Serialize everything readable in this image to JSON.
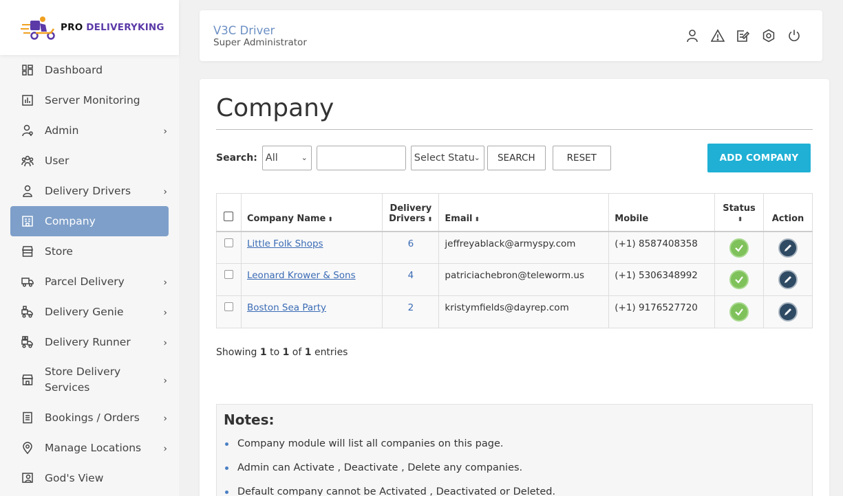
{
  "brand": {
    "pro": "PRO",
    "name": "DELIVERYKING"
  },
  "header": {
    "user_name": "V3C Driver",
    "user_role": "Super Administrator"
  },
  "sidebar": {
    "items": [
      {
        "label": "Dashboard",
        "icon": "dashboard-icon",
        "has_submenu": false
      },
      {
        "label": "Server Monitoring",
        "icon": "chart-icon",
        "has_submenu": false
      },
      {
        "label": "Admin",
        "icon": "admin-user-icon",
        "has_submenu": true
      },
      {
        "label": "User",
        "icon": "users-icon",
        "has_submenu": false
      },
      {
        "label": "Delivery Drivers",
        "icon": "driver-icon",
        "has_submenu": true
      },
      {
        "label": "Company",
        "icon": "building-icon",
        "has_submenu": false,
        "active": true
      },
      {
        "label": "Store",
        "icon": "store-icon",
        "has_submenu": false
      },
      {
        "label": "Parcel Delivery",
        "icon": "truck-icon",
        "has_submenu": true
      },
      {
        "label": "Delivery Genie",
        "icon": "genie-icon",
        "has_submenu": true
      },
      {
        "label": "Delivery Runner",
        "icon": "runner-icon",
        "has_submenu": true
      },
      {
        "label": "Store Delivery Services",
        "icon": "store-delivery-icon",
        "has_submenu": true
      },
      {
        "label": "Bookings / Orders",
        "icon": "orders-icon",
        "has_submenu": true
      },
      {
        "label": "Manage Locations",
        "icon": "location-icon",
        "has_submenu": true
      },
      {
        "label": "God's View",
        "icon": "gods-view-icon",
        "has_submenu": false
      }
    ],
    "chevron": "›"
  },
  "page": {
    "title": "Company"
  },
  "search": {
    "label": "Search:",
    "filter_value": "All",
    "input_value": "",
    "status_placeholder": "Select Statu",
    "search_button": "SEARCH",
    "reset_button": "RESET",
    "add_button": "ADD COMPANY"
  },
  "table": {
    "headers": {
      "company_name": "Company Name",
      "delivery_drivers_1": "Delivery",
      "delivery_drivers_2": "Drivers",
      "email": "Email",
      "mobile": "Mobile",
      "status": "Status",
      "action": "Action",
      "sort_glyph": "⬍"
    },
    "rows": [
      {
        "name": "Little Folk Shops",
        "drivers": "6",
        "email": "jeffreyablack@armyspy.com",
        "mobile": "(+1) 8587408358"
      },
      {
        "name": "Leonard Krower & Sons",
        "drivers": "4",
        "email": "patriciachebron@teleworm.us",
        "mobile": "(+1) 5306348992"
      },
      {
        "name": "Boston Sea Party",
        "drivers": "2",
        "email": "kristymfields@dayrep.com",
        "mobile": "(+1) 9176527720"
      }
    ]
  },
  "pagination": {
    "prefix": "Showing ",
    "from": "1",
    "to_word": " to ",
    "to": "1",
    "of_word": " of ",
    "total": "1",
    "suffix": " entries"
  },
  "notes": {
    "title": "Notes:",
    "items": [
      "Company module will list all companies on this page.",
      "Admin can Activate , Deactivate , Delete any companies.",
      "Default company cannot be Activated , Deactivated or Deleted."
    ]
  },
  "colors": {
    "accent": "#20b0d5",
    "active_nav": "#7e9fc9",
    "link": "#3a6bb5",
    "status_ok": "#7fc15a",
    "edit": "#2f4a63"
  }
}
